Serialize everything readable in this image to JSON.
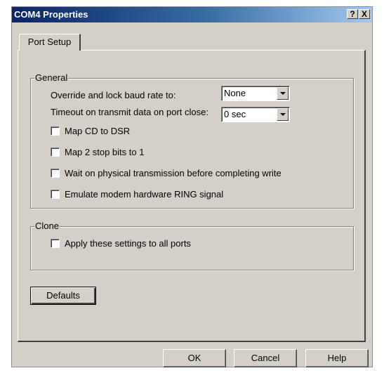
{
  "window": {
    "title": "COM4 Properties",
    "help_button": "?",
    "close_button": "X"
  },
  "tab": {
    "label": "Port Setup"
  },
  "general": {
    "legend": "General",
    "baud_label": "Override and lock baud rate to:",
    "baud_value": "None",
    "timeout_label": "Timeout on transmit data on port close:",
    "timeout_value": "0 sec",
    "checkboxes": [
      {
        "label": "Map CD to DSR",
        "checked": false
      },
      {
        "label": "Map 2 stop bits to 1",
        "checked": false
      },
      {
        "label": "Wait on physical transmission before completing write",
        "checked": false
      },
      {
        "label": "Emulate modem hardware RING signal",
        "checked": false
      }
    ]
  },
  "clone": {
    "legend": "Clone",
    "checkbox": {
      "label": "Apply these settings to all ports",
      "checked": false
    }
  },
  "buttons": {
    "defaults": "Defaults",
    "ok": "OK",
    "cancel": "Cancel",
    "help": "Help"
  }
}
